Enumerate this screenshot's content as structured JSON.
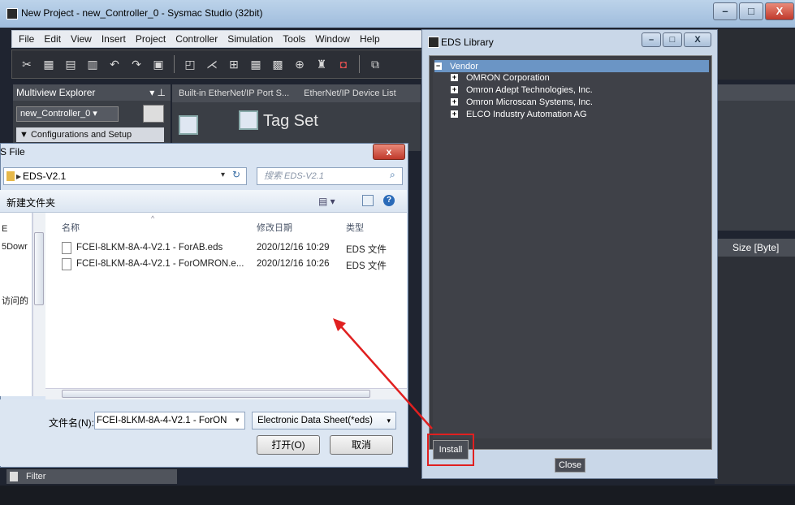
{
  "main_window": {
    "title": "New Project - new_Controller_0 - Sysmac Studio (32bit)",
    "menu": [
      "File",
      "Edit",
      "View",
      "Insert",
      "Project",
      "Controller",
      "Simulation",
      "Tools",
      "Window",
      "Help"
    ],
    "controls": [
      "–",
      "□",
      "X"
    ]
  },
  "multiview": {
    "title": "Multiview Explorer",
    "controller": "new_Controller_0",
    "section": "Configurations and Setup"
  },
  "tabs": [
    "Built-in EtherNet/IP Port S...",
    "EtherNet/IP Device List"
  ],
  "tag_set": "Tag Set",
  "right_panel": {
    "size_header": "Size [Byte]"
  },
  "filter_bar": {
    "label": "Filter"
  },
  "file_dialog": {
    "title": "S File",
    "path": "EDS-V2.1",
    "search_placeholder": "搜索 EDS-V2.1",
    "new_folder": "新建文件夹",
    "columns": {
      "name": "名称",
      "date": "修改日期",
      "type": "类型"
    },
    "nav_items": [
      "E",
      "5Dowr",
      "访问的"
    ],
    "files": [
      {
        "name": "FCEI-8LKM-8A-4-V2.1 - ForAB.eds",
        "date": "2020/12/16 10:29",
        "type": "EDS 文件"
      },
      {
        "name": "FCEI-8LKM-8A-4-V2.1 - ForOMRON.e...",
        "date": "2020/12/16 10:26",
        "type": "EDS 文件"
      }
    ],
    "filename_label": "文件名(N):",
    "filename_value": "FCEI-8LKM-8A-4-V2.1 - ForON",
    "filter_value": "Electronic Data Sheet(*eds)",
    "open_button": "打开(O)",
    "cancel_button": "取消"
  },
  "eds_library": {
    "title": "EDS Library",
    "root": "Vendor",
    "vendors": [
      "OMRON Corporation",
      "Omron Adept Technologies, Inc.",
      "Omron Microscan Systems, Inc.",
      "ELCO Industry Automation AG"
    ],
    "install_button": "Install",
    "close_button": "Close"
  },
  "colors": {
    "annotation": "#e02020",
    "accent": "#6b95c5"
  }
}
